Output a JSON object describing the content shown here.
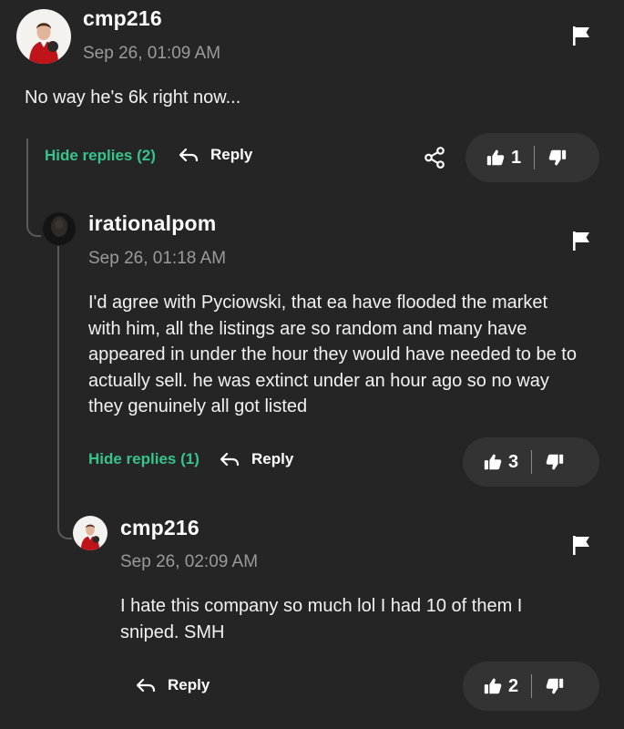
{
  "comment": {
    "username": "cmp216",
    "timestamp": "Sep 26, 01:09 AM",
    "text": "No way he's 6k right now...",
    "hide_replies_label": "Hide replies (2)",
    "reply_label": "Reply",
    "likes": "1"
  },
  "reply1": {
    "username": "irationalpom",
    "timestamp": "Sep 26, 01:18 AM",
    "text": "I'd agree with Pyciowski, that ea have flooded the market with him, all the listings are so random and many have appeared in under the hour they would have needed to be to actually sell. he was extinct under an hour ago so no way they genuinely all got listed",
    "hide_replies_label": "Hide replies (1)",
    "reply_label": "Reply",
    "likes": "3"
  },
  "reply2": {
    "username": "cmp216",
    "timestamp": "Sep 26, 02:09 AM",
    "text": "I hate this company so much lol I had 10 of them I sniped. SMH",
    "reply_label": "Reply",
    "likes": "2"
  },
  "colors": {
    "background": "#252525",
    "accent": "#37c48c",
    "muted_text": "#9b9b9b",
    "pill": "#333333"
  },
  "icons": [
    "avatar-image",
    "flag-icon",
    "reply-arrow-icon",
    "share-icon",
    "thumbs-up-icon",
    "thumbs-down-icon"
  ]
}
